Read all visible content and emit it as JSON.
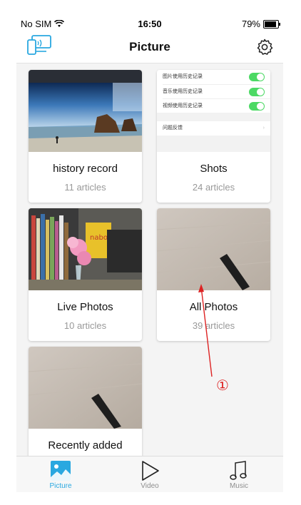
{
  "status_bar": {
    "carrier": "No SIM",
    "time": "16:50",
    "battery": "79%"
  },
  "header": {
    "title": "Picture"
  },
  "albums": [
    {
      "title": "history record",
      "count": "11 articles"
    },
    {
      "title": "Shots",
      "count": "24 articles",
      "thumb_settings": [
        {
          "label": "图片使用历史记录",
          "toggle": true
        },
        {
          "label": "音乐使用历史记录",
          "toggle": true
        },
        {
          "label": "视频使用历史记录",
          "toggle": true
        },
        {
          "label": "问题反馈",
          "toggle": false
        }
      ]
    },
    {
      "title": "Live Photos",
      "count": "10 articles"
    },
    {
      "title": "All Photos",
      "count": "39 articles"
    },
    {
      "title": "Recently added",
      "count": ""
    }
  ],
  "tabs": [
    {
      "label": "Picture",
      "icon": "picture-icon",
      "active": true
    },
    {
      "label": "Video",
      "icon": "play-icon",
      "active": false
    },
    {
      "label": "Music",
      "icon": "music-note-icon",
      "active": false
    }
  ],
  "annotation": {
    "marker": "①",
    "color": "#dd2222"
  },
  "colors": {
    "accent": "#29a8e0",
    "toggle_on": "#4cd964"
  }
}
